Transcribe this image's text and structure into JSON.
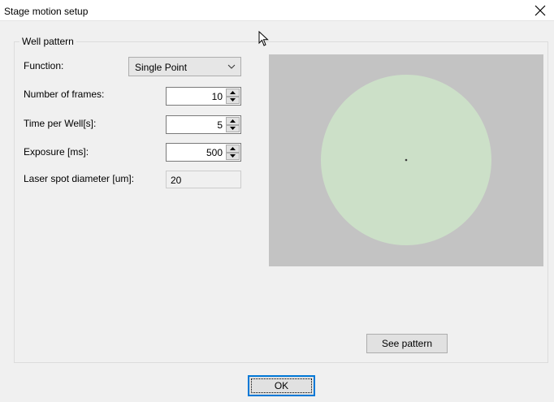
{
  "window": {
    "title": "Stage motion setup",
    "close_icon": "close-icon"
  },
  "well_pattern": {
    "group_title": "Well pattern",
    "function": {
      "label": "Function:",
      "selected": "Single Point"
    },
    "number_of_frames": {
      "label": "Number of frames:",
      "value": "10"
    },
    "time_per_well": {
      "label": "Time per Well[s]:",
      "value": "5"
    },
    "exposure": {
      "label": "Exposure [ms]:",
      "value": "500"
    },
    "laser_spot_diameter": {
      "label": "Laser spot diameter [um]:",
      "value": "20"
    },
    "preview": {
      "background_color": "#c3c3c3",
      "well_color": "#cce0c8",
      "point_color": "#3a3a3a"
    },
    "see_pattern_label": "See pattern"
  },
  "footer": {
    "ok_label": "OK"
  }
}
